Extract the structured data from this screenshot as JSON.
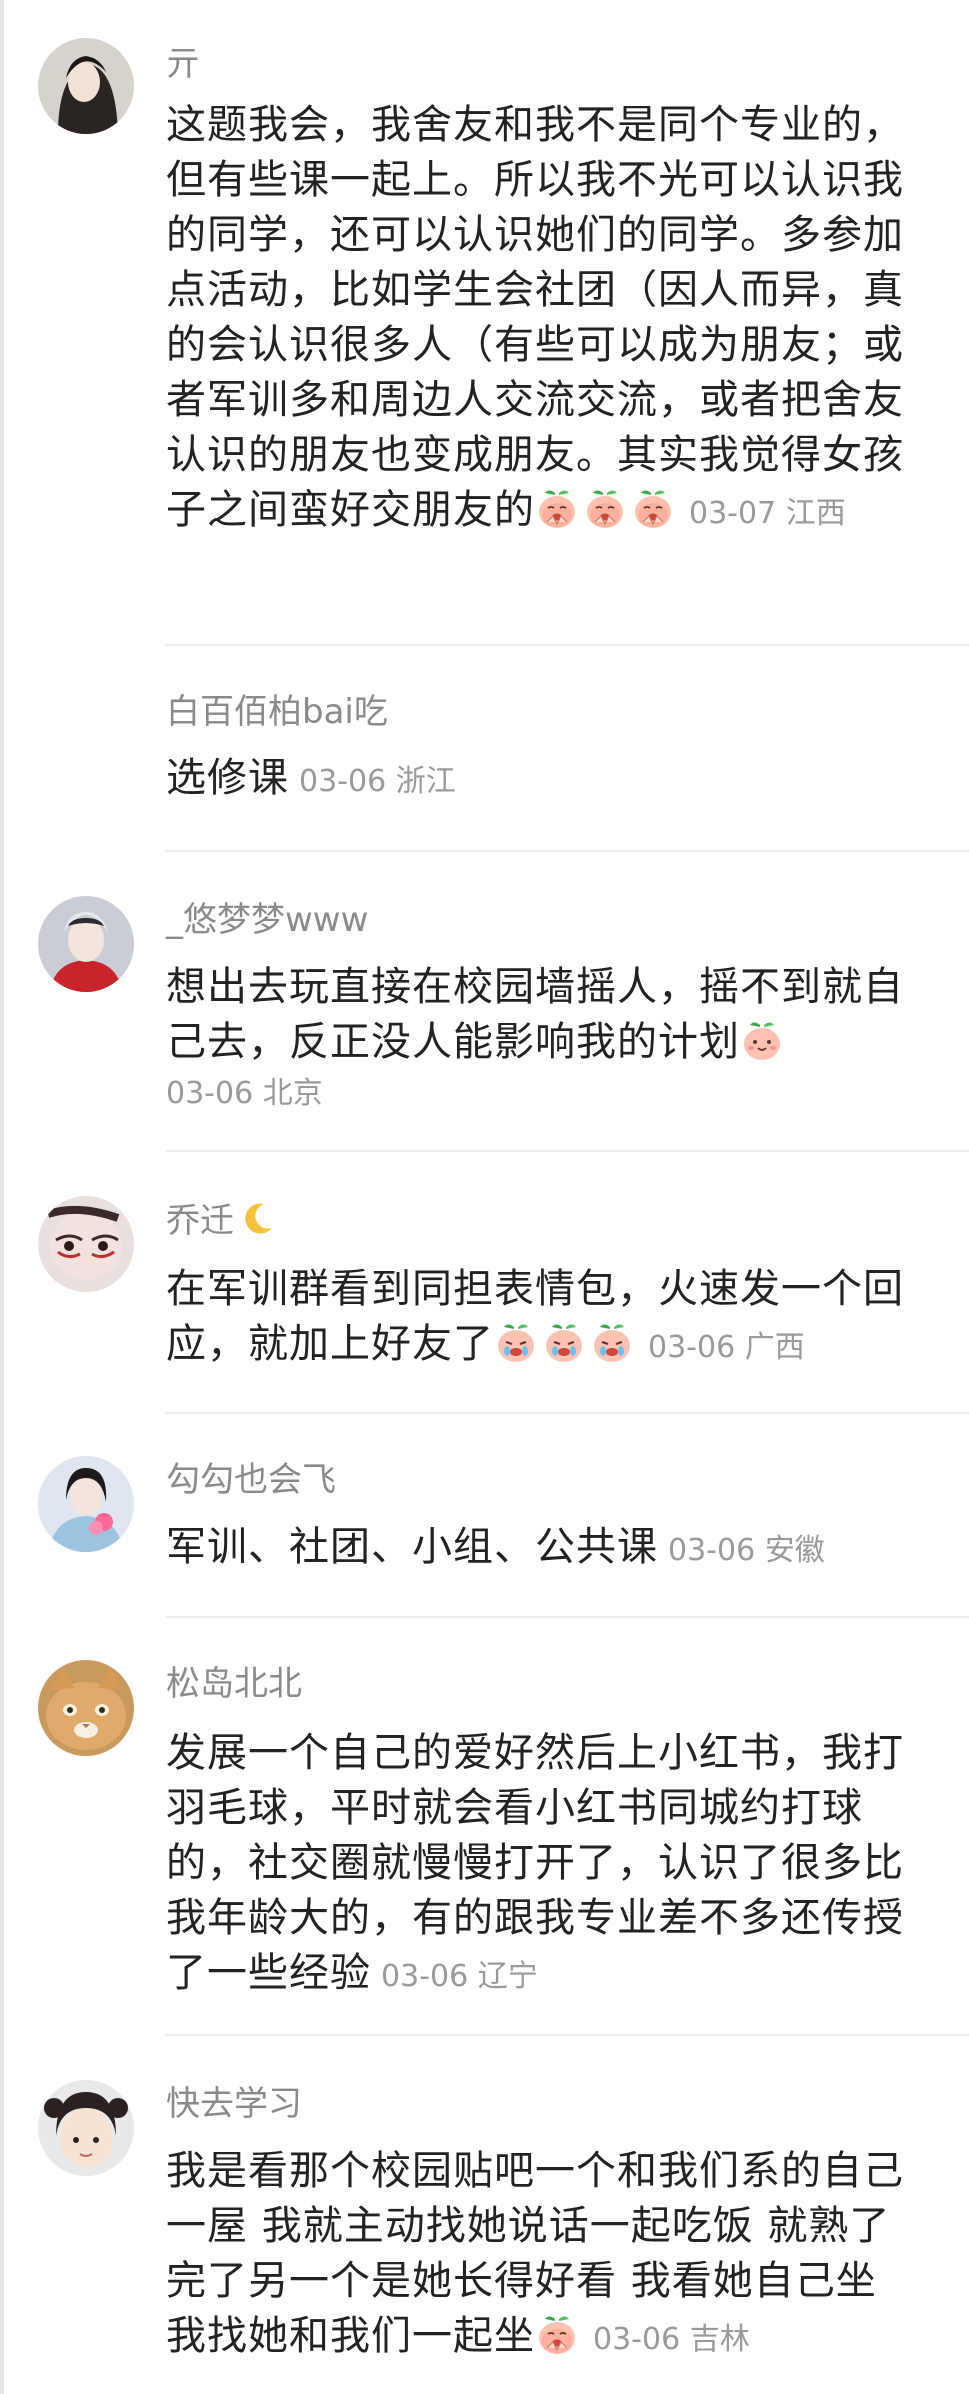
{
  "comments": [
    {
      "user": "亓",
      "text": "这题我会，我舍友和我不是同个专业的，但有些课一起上。所以我不光可以认识我的同学，还可以认识她们的同学。多参加点活动，比如学生会社团（因人而异，真的会认识很多人（有些可以成为朋友；或者军训多和周边人交流交流，或者把舍友认识的朋友也变成朋友。其实我觉得女孩子之间蛮好交朋友的",
      "emojis": [
        "peach-pray-emoji",
        "peach-pray-emoji",
        "peach-pray-emoji"
      ],
      "meta": "03-07 江西"
    },
    {
      "user": "白百佰柏bai吃",
      "text": "选修课",
      "meta": "03-06 浙江"
    },
    {
      "user": "_悠梦梦www",
      "text": "想出去玩直接在校园墙摇人，摇不到就自己去，反正没人能影响我的计划",
      "emojis": [
        "peach-smile-emoji"
      ],
      "meta": "03-06 北京"
    },
    {
      "user": "乔迁",
      "user_emoji": "crescent-moon-icon",
      "text": "在军训群看到同担表情包，火速发一个回应，就加上好友了",
      "emojis": [
        "peach-cry-emoji",
        "peach-cry-emoji",
        "peach-cry-emoji"
      ],
      "meta": "03-06 广西"
    },
    {
      "user": "勾勾也会飞",
      "text": "军训、社团、小组、公共课",
      "meta": "03-06 安徽"
    },
    {
      "user": "松岛北北",
      "text": "发展一个自己的爱好然后上小红书，我打羽毛球，平时就会看小红书同城约打球的，社交圈就慢慢打开了，认识了很多比我年龄大的，有的跟我专业差不多还传授了一些经验",
      "meta": "03-06 辽宁"
    },
    {
      "user": "快去学习",
      "text": "我是看那个校园贴吧一个和我们系的自己一屋 我就主动找她说话一起吃饭 就熟了 完了另一个是她长得好看 我看她自己坐 我找她和我们一起坐",
      "emojis": [
        "peach-pray-emoji"
      ],
      "meta": "03-06 吉林"
    }
  ],
  "colors": {
    "username": "#8a8a8a",
    "body_text": "#222222",
    "meta": "#9a9a9a",
    "divider": "#ececec"
  }
}
